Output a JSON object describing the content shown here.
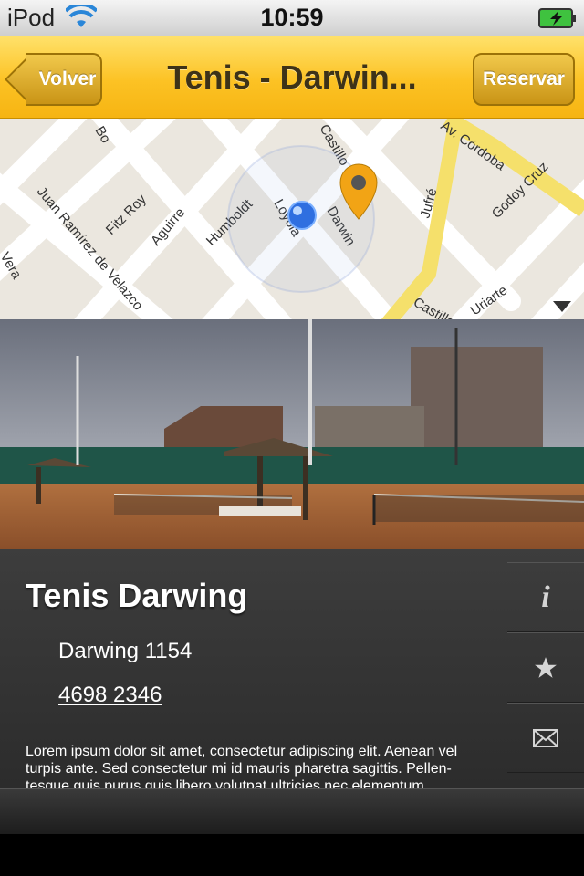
{
  "status": {
    "carrier": "iPod",
    "time": "10:59"
  },
  "navbar": {
    "back_label": "Volver",
    "title": "Tenis - Darwin...",
    "reserve_label": "Reservar"
  },
  "map": {
    "streets": [
      "Castillo",
      "Av. Córdoba",
      "Juan Ramírez de Velazco",
      "Fitz Roy",
      "Aguirre",
      "Humboldt",
      "Loyola",
      "Darwin",
      "Jufré",
      "Godoy Cruz",
      "Vera",
      "Castillo",
      "Uriarte",
      "Bo"
    ]
  },
  "venue": {
    "name": "Tenis Darwing",
    "address": "Darwing 1154",
    "phone": "4698 2346",
    "description": "Lorem ipsum dolor sit amet, consectetur adipiscing elit. Aenean vel turpis ante. Sed consectetur mi id mauris pharetra sagittis. Pellen-tesque quis purus quis libero volutpat ultricies nec elementum"
  },
  "side_actions": [
    {
      "icon": "info-icon"
    },
    {
      "icon": "star-icon"
    },
    {
      "icon": "mail-icon"
    }
  ]
}
